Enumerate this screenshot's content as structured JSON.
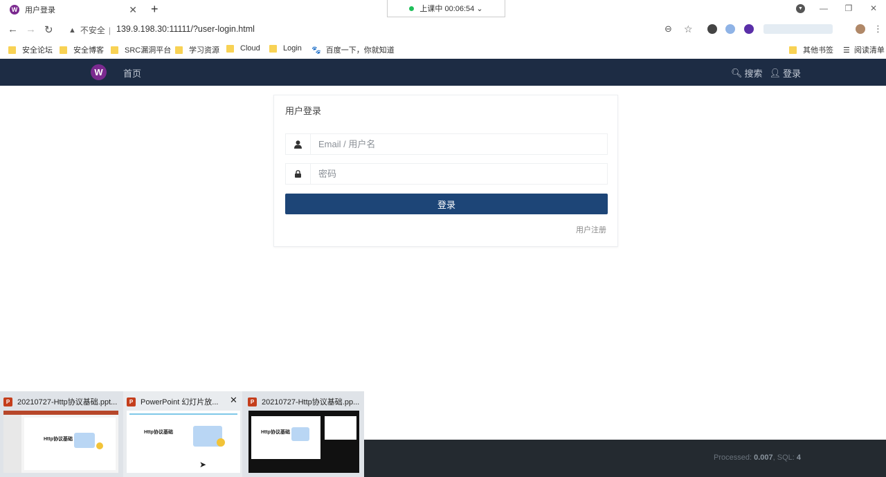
{
  "browser": {
    "tab": {
      "title": "用户登录",
      "favicon": "W"
    },
    "recording_indicator": "上课中 00:06:54 ⌄",
    "insecure_label": "不安全",
    "url": "139.9.198.30:11111/?user-login.html",
    "bookmarks": [
      "安全论坛",
      "安全博客",
      "SRC漏洞平台",
      "学习资源",
      "Cloud",
      "Login",
      "百度一下，你就知道"
    ],
    "other_bookmarks": "其他书签",
    "reading_list": "阅读清单"
  },
  "site": {
    "logo": "W",
    "nav_home": "首页",
    "nav_search": "搜索",
    "nav_login": "登录"
  },
  "login": {
    "title": "用户登录",
    "username_placeholder": "Email / 用户名",
    "password_placeholder": "密码",
    "submit_label": "登录",
    "register_link": "用户注册"
  },
  "footer": {
    "processed_label": "Processed:",
    "processed_value": "0.007",
    "sql_label": "SQL:",
    "sql_value": "4"
  },
  "taskbar_previews": [
    {
      "title": "20210727-Http协议基础.ppt...",
      "slide_title": "Http协议基础"
    },
    {
      "title": "PowerPoint 幻灯片放...",
      "slide_title": "Http协议基础"
    },
    {
      "title": "20210727-Http协议基础.pp...",
      "slide_title": "Http协议基础"
    }
  ],
  "colors": {
    "nav_bg": "#1d2c44",
    "button_bg": "#1d4577",
    "footer_bg": "#242a30",
    "logo": "#7b2a8f"
  }
}
